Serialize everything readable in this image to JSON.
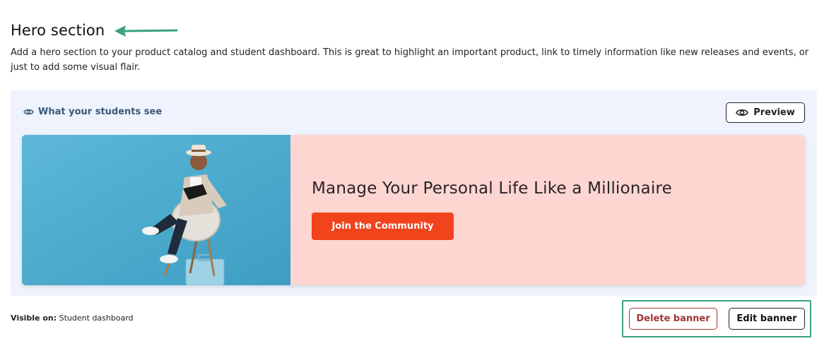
{
  "header": {
    "title": "Hero section",
    "description": "Add a hero section to your product catalog and student dashboard. This is great to highlight an important product, link to timely information like new releases and events, or just to add some visual flair."
  },
  "preview": {
    "label": "What your students see",
    "preview_button": "Preview",
    "banner": {
      "heading": "Manage Your Personal Life Like a Millionaire",
      "cta": "Join the Community",
      "image_icon": "person-reading-photo"
    }
  },
  "footer": {
    "visible_on_label": "Visible on:",
    "visible_on_value": "Student dashboard",
    "delete_button": "Delete banner",
    "edit_button": "Edit banner"
  },
  "colors": {
    "panel_bg": "#eef3fd",
    "banner_pink": "#fdd6d2",
    "cta_orange": "#f1431c",
    "delete_red": "#a03535",
    "annotation_green": "#3aa37c",
    "photo_blue": "#54aed0"
  }
}
